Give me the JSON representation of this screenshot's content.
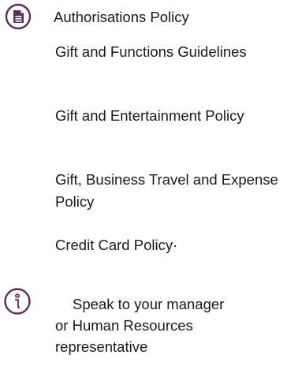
{
  "policies": {
    "icon": "document-icon",
    "items": [
      {
        "label": "Authorisations Policy"
      },
      {
        "label": "Gift and Functions Guidelines"
      },
      {
        "label": "Gift and Entertainment Policy"
      },
      {
        "label": "Gift, Business Travel and Expense Policy"
      },
      {
        "label": "Credit Card Policy·"
      }
    ]
  },
  "contact": {
    "icon": "info-icon",
    "line1": "Speak to your manager",
    "line2": "or Human Resources representative"
  },
  "colors": {
    "accent": "#5c2a5c",
    "text": "#1a1a1a"
  }
}
